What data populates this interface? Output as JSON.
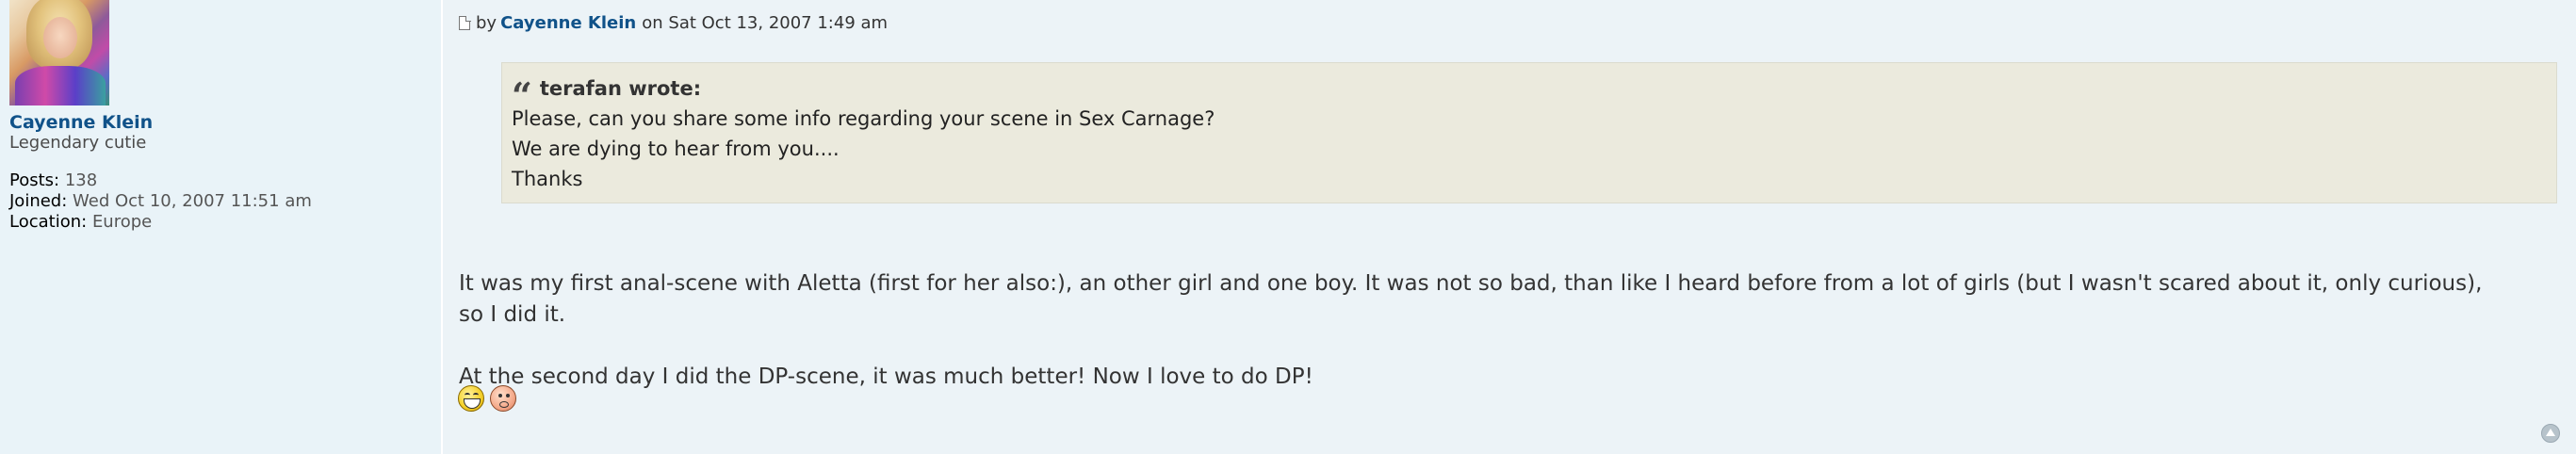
{
  "profile": {
    "username": "Cayenne Klein",
    "rank": "Legendary cutie",
    "posts_label": "Posts:",
    "posts_value": "138",
    "joined_label": "Joined:",
    "joined_value": "Wed Oct 10, 2007 11:51 am",
    "location_label": "Location:",
    "location_value": "Europe"
  },
  "post": {
    "icon": "post-icon",
    "by_prefix": "by",
    "author": "Cayenne Klein",
    "date": "on Sat Oct 13, 2007 1:49 am",
    "quote": {
      "cite": "terafan wrote:",
      "lines": [
        "Please, can you share some info regarding your scene in Sex Carnage?",
        "We are dying to hear from you....",
        "Thanks"
      ]
    },
    "paragraph1": "It was my first anal-scene with Aletta (first for her also:), an other girl and one boy. It was not so bad, than like I heard before from a lot of girls (but I wasn't scared about it, only curious), so I did it.",
    "paragraph2": "At the second day I did the DP-scene, it was much better! Now I love to do DP!",
    "smileys": [
      "laughing-smiley-icon",
      "blushing-smiley-icon"
    ]
  },
  "colors": {
    "link": "#105289",
    "post_bg": "#ecf3f7",
    "quote_bg": "#ebeadd"
  }
}
